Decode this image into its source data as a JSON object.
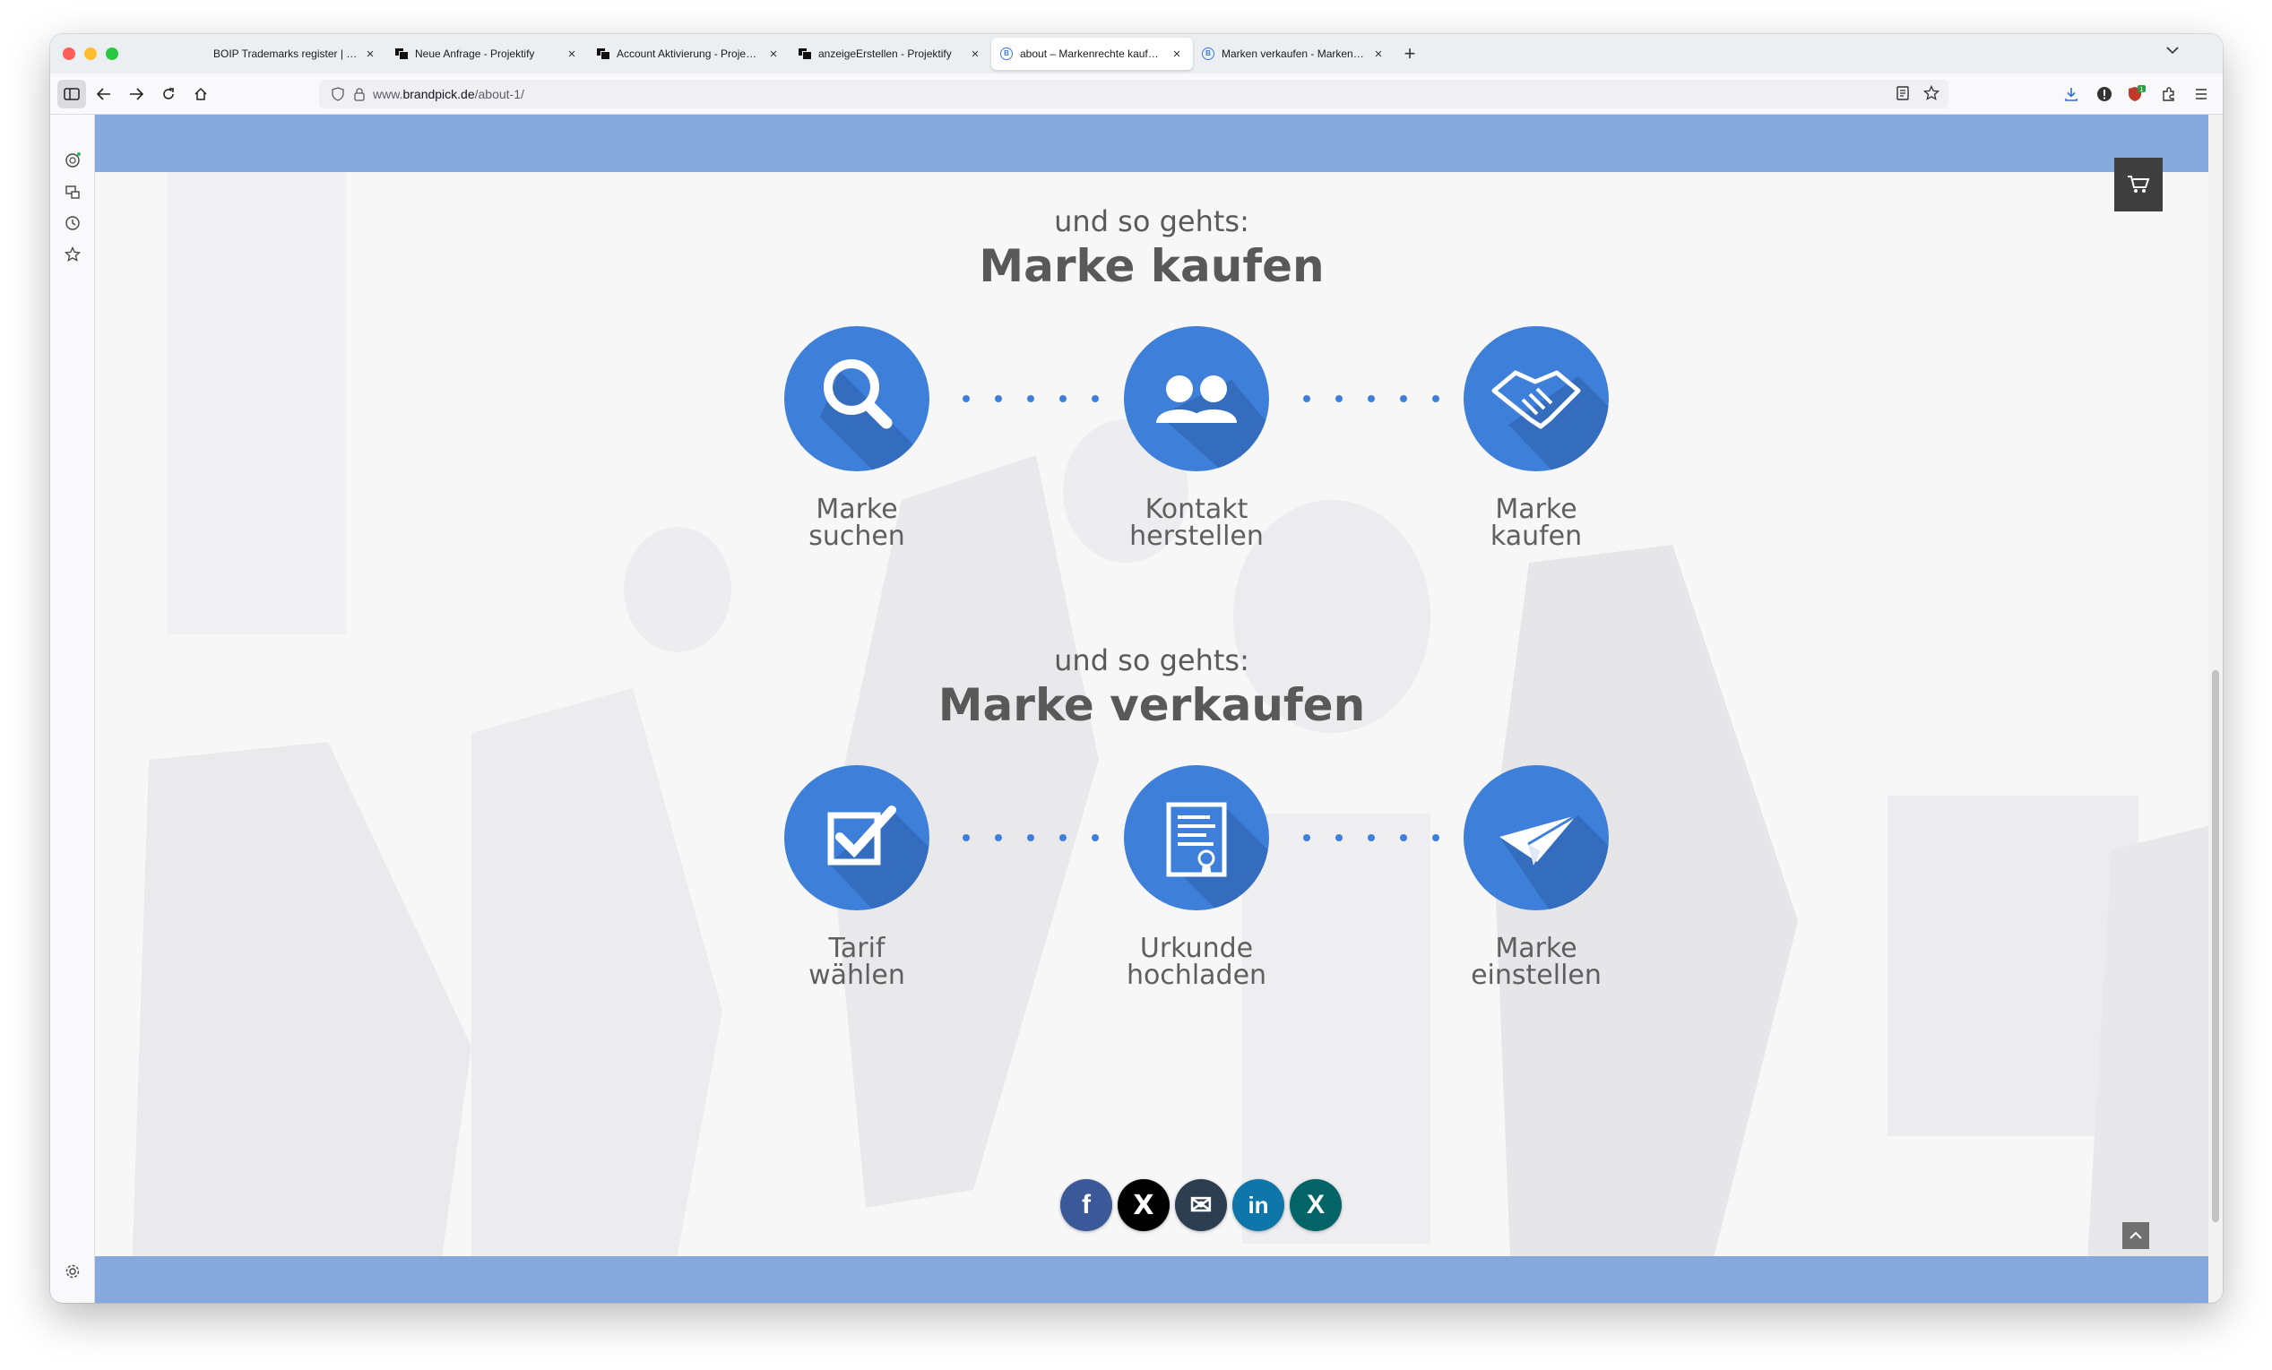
{
  "browser": {
    "tabs": [
      {
        "label": "BOIP Trademarks register | Benelux",
        "favicon": "none",
        "active": false
      },
      {
        "label": "Neue Anfrage - Projektify",
        "favicon": "projektify-icon",
        "active": false
      },
      {
        "label": "Account Aktivierung - Projektify",
        "favicon": "projektify-icon",
        "active": false
      },
      {
        "label": "anzeigeErstellen - Projektify",
        "favicon": "projektify-icon",
        "active": false
      },
      {
        "label": "about – Markenrechte kaufen und",
        "favicon": "brandpick-icon",
        "active": true
      },
      {
        "label": "Marken verkaufen - Markenrecht",
        "favicon": "brandpick-icon",
        "active": false
      }
    ],
    "close_glyph": "×",
    "new_tab_glyph": "+",
    "url": {
      "prefix": "www.",
      "host": "brandpick.de",
      "path": "/about-1/"
    },
    "extension_badge": "1"
  },
  "page": {
    "buy": {
      "subtitle": "und so gehts:",
      "title": "Marke kaufen",
      "steps": [
        {
          "line1": "Marke",
          "line2": "suchen",
          "icon": "search-icon"
        },
        {
          "line1": "Kontakt",
          "line2": "herstellen",
          "icon": "users-icon"
        },
        {
          "line1": "Marke",
          "line2": "kaufen",
          "icon": "handshake-icon"
        }
      ]
    },
    "sell": {
      "subtitle": "und so gehts:",
      "title": "Marke verkaufen",
      "steps": [
        {
          "line1": "Tarif",
          "line2": "wählen",
          "icon": "checkbox-icon"
        },
        {
          "line1": "Urkunde",
          "line2": "hochladen",
          "icon": "certificate-icon"
        },
        {
          "line1": "Marke",
          "line2": "einstellen",
          "icon": "paper-plane-icon"
        }
      ]
    },
    "social": [
      {
        "name": "facebook",
        "glyph": "f",
        "color": "#3b5998"
      },
      {
        "name": "x",
        "glyph": "X",
        "color": "#000000"
      },
      {
        "name": "email",
        "glyph": "✉",
        "color": "#2c3e50"
      },
      {
        "name": "linkedin",
        "glyph": "in",
        "color": "#0e76a8"
      },
      {
        "name": "xing",
        "glyph": "X",
        "color": "#026466"
      }
    ]
  },
  "colors": {
    "accent": "#3e7fd9",
    "band": "#85a8dd",
    "text": "#595959"
  }
}
